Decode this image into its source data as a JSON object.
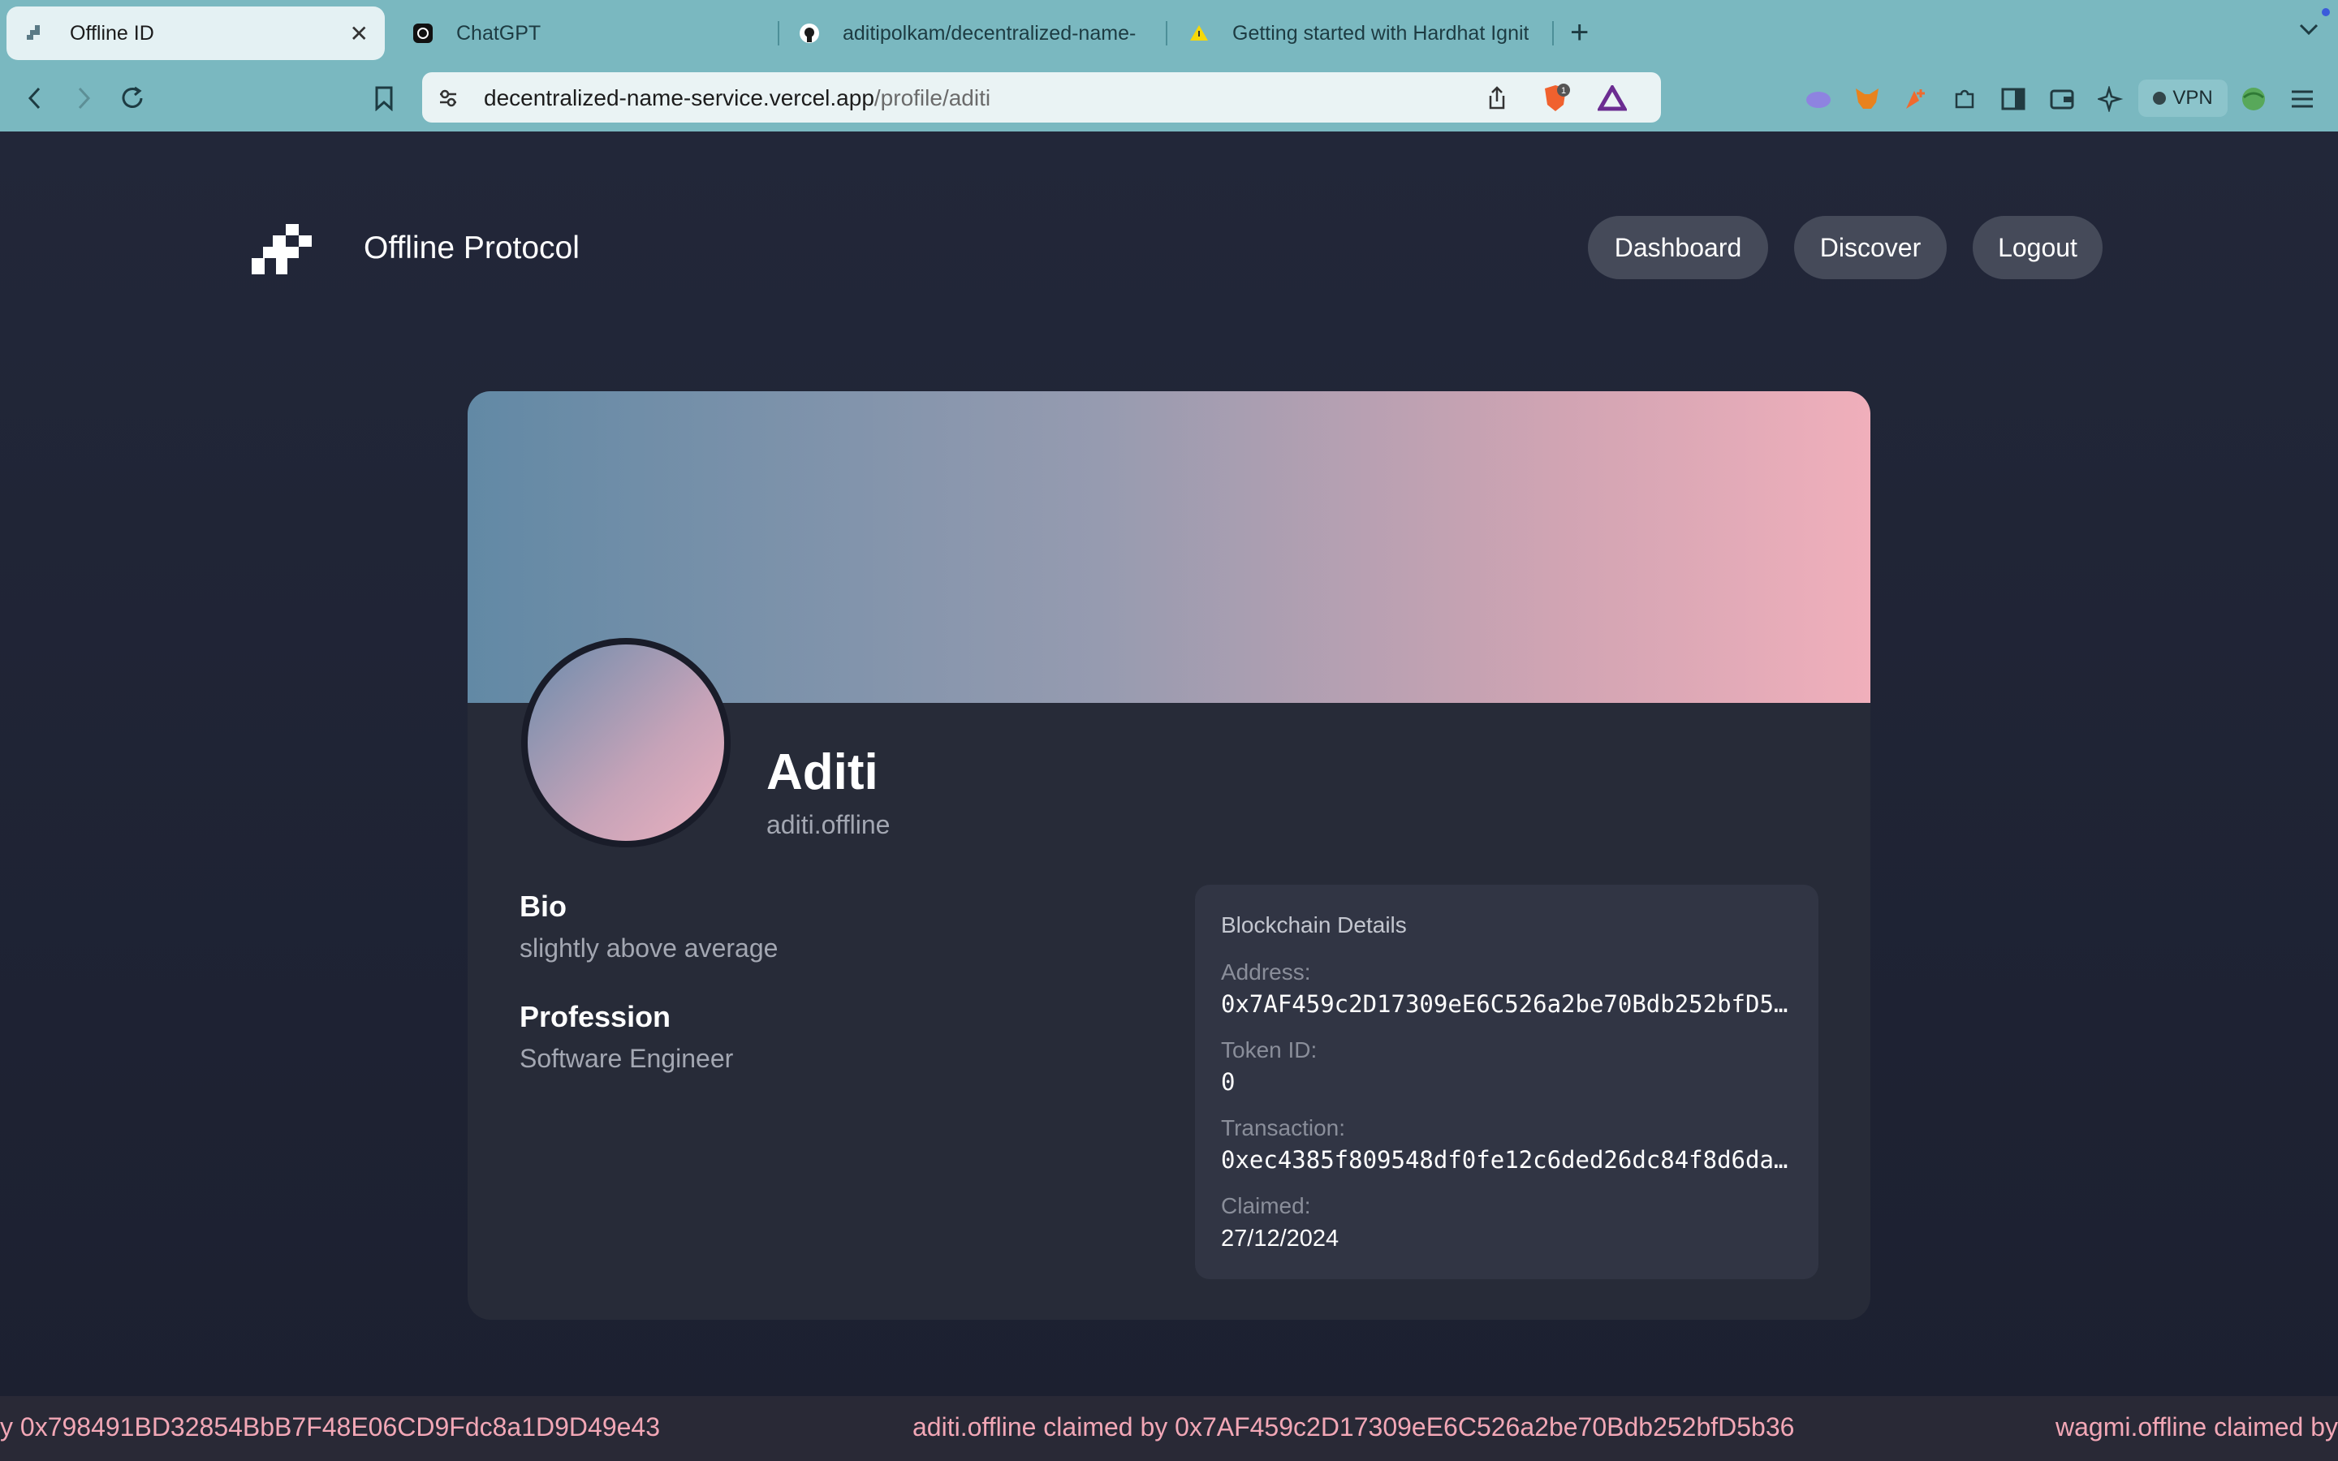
{
  "browser": {
    "tabs": [
      {
        "title": "Offline ID",
        "active": true
      },
      {
        "title": "ChatGPT"
      },
      {
        "title": "aditipolkam/decentralized-name-"
      },
      {
        "title": "Getting started with Hardhat Ignit"
      }
    ],
    "url_host": "decentralized-name-service.vercel.app",
    "url_path": "/profile/aditi",
    "shield_badge": "1",
    "vpn_label": "VPN"
  },
  "header": {
    "brand": "Offline Protocol",
    "nav": [
      "Dashboard",
      "Discover",
      "Logout"
    ]
  },
  "profile": {
    "name": "Aditi",
    "handle": "aditi.offline",
    "bio_label": "Bio",
    "bio": "slightly above average",
    "profession_label": "Profession",
    "profession": "Software Engineer"
  },
  "blockchain": {
    "title": "Blockchain Details",
    "address_label": "Address:",
    "address": "0x7AF459c2D17309eE6C526a2be70Bdb252bfD5b36",
    "token_label": "Token ID:",
    "token": "0",
    "tx_label": "Transaction:",
    "tx": "0xec4385f809548df0fe12c6ded26dc84f8d6da8...",
    "claimed_label": "Claimed:",
    "claimed": "27/12/2024"
  },
  "ticker": [
    "y 0x798491BD32854BbB7F48E06CD9Fdc8a1D9D49e43",
    "aditi.offline claimed by 0x7AF459c2D17309eE6C526a2be70Bdb252bfD5b36",
    "wagmi.offline claimed by"
  ],
  "colors": {
    "page_bg": "#1e2233",
    "card_bg": "#272b38",
    "banner_start": "#6289a5",
    "banner_end": "#f0afbb",
    "ticker_text": "#f2a7b6",
    "chrome_bg": "#7ab8c0"
  }
}
